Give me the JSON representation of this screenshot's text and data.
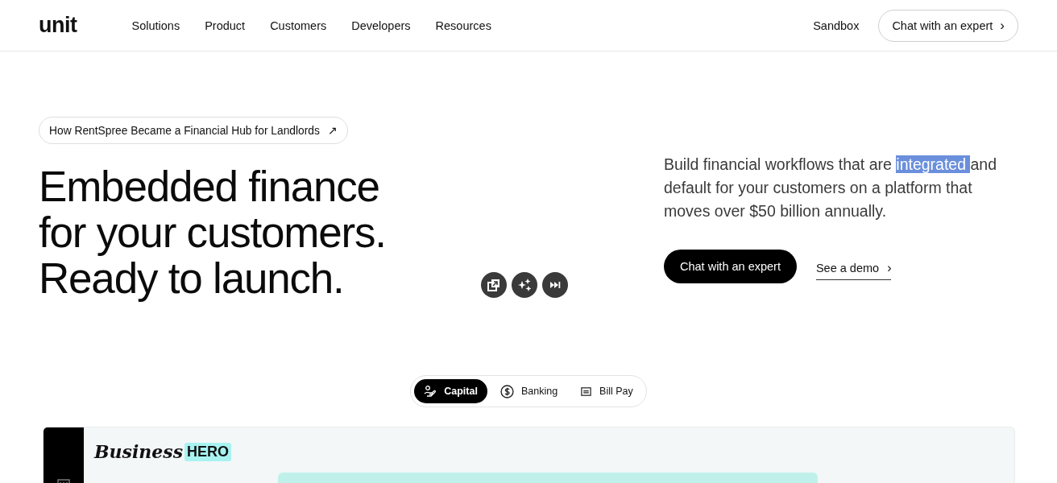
{
  "header": {
    "logo": "unit",
    "nav": [
      "Solutions",
      "Product",
      "Customers",
      "Developers",
      "Resources"
    ],
    "sandbox_link": "Sandbox",
    "cta_button": "Chat with an expert",
    "cta_arrow": "›"
  },
  "hero": {
    "story_link": "How RentSpree Became a Financial Hub for Landlords",
    "story_arrow": "↗",
    "heading": [
      "Embedded finance",
      "for your customers.",
      "Ready to launch."
    ],
    "description": {
      "text_before": "Build financial workflows that are ",
      "highlighted_text": "integrated ",
      "text_after": "and default for your customers on a platform that moves over $50 billion annually."
    },
    "primary_button": "Chat with an expert",
    "demo_link": "See a demo",
    "demo_arrow": "›"
  },
  "floating_tools": [
    {
      "kind": "popout"
    },
    {
      "kind": "sparkle"
    },
    {
      "kind": "skip"
    }
  ],
  "product_tabs": [
    {
      "label": "Capital",
      "selected": true
    },
    {
      "label": "Banking",
      "selected": false
    },
    {
      "label": "Bill Pay",
      "selected": false
    }
  ],
  "preview": {
    "brand_script": "Business",
    "brand_badge": "HERO"
  }
}
